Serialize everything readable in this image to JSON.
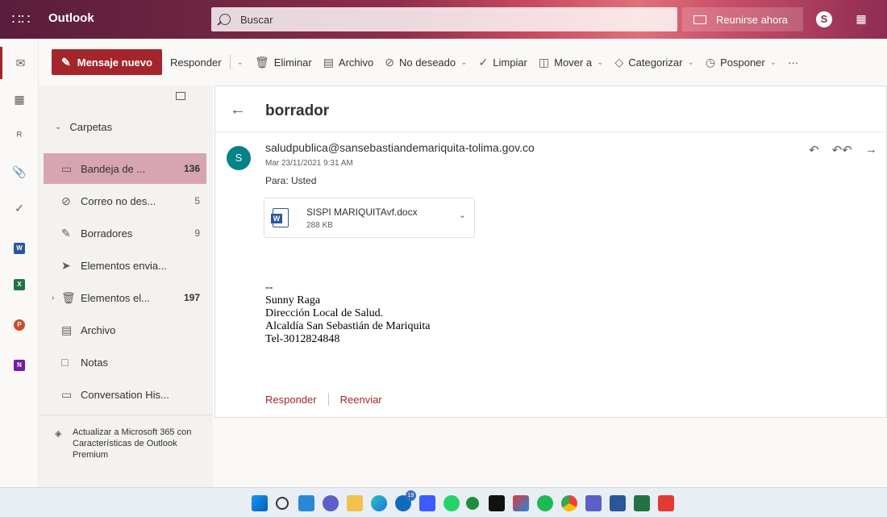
{
  "topbar": {
    "app_name": "Outlook",
    "search_placeholder": "Buscar",
    "meet_now": "Reunirse ahora",
    "skype_label": "S"
  },
  "rail": {
    "items": [
      "mail-icon",
      "calendar-icon",
      "people-icon",
      "attachment-icon",
      "todo-icon",
      "word-icon",
      "excel-icon",
      "powerpoint-icon",
      "onenote-icon"
    ]
  },
  "toolbar": {
    "new_message": "Mensaje nuevo",
    "reply": "Responder",
    "delete": "Eliminar",
    "archive": "Archivo",
    "junk": "No deseado",
    "sweep": "Limpiar",
    "move_to": "Mover a",
    "categorize": "Categorizar",
    "snooze": "Posponer",
    "more": "···"
  },
  "folders": {
    "header": "Carpetas",
    "items": [
      {
        "label": "Bandeja de ...",
        "count": "136"
      },
      {
        "label": "Correo no des...",
        "count": "5"
      },
      {
        "label": "Borradores",
        "count": "9"
      },
      {
        "label": "Elementos envia...",
        "count": ""
      },
      {
        "label": "Elementos el...",
        "count": "197"
      },
      {
        "label": "Archivo",
        "count": ""
      },
      {
        "label": "Notas",
        "count": ""
      },
      {
        "label": "Conversation His...",
        "count": ""
      }
    ],
    "upgrade_text": "Actualizar a Microsoft 365 con Características de Outlook Premium"
  },
  "message": {
    "subject": "borrador",
    "avatar_initial": "S",
    "sender": "saludpublica@sansebastiandemariquita-tolima.gov.co",
    "date": "Mar 23/11/2021 9:31 AM",
    "to": "Para: Usted",
    "attachment": {
      "name": "SISPI MARIQUITAvf.docx",
      "size": "288 KB",
      "type_badge": "W"
    },
    "signature": [
      "--",
      "Sunny Raga",
      "Dirección Local de Salud.",
      "Alcaldía San Sebastián de Mariquita",
      "Tel-3012824848"
    ],
    "reply_link": "Responder",
    "forward_link": "Reenviar"
  },
  "taskbar": {
    "mail_badge": "19"
  },
  "colors": {
    "accent": "#a4262c",
    "selected_folder": "#d6a4b3",
    "avatar": "#038387"
  }
}
